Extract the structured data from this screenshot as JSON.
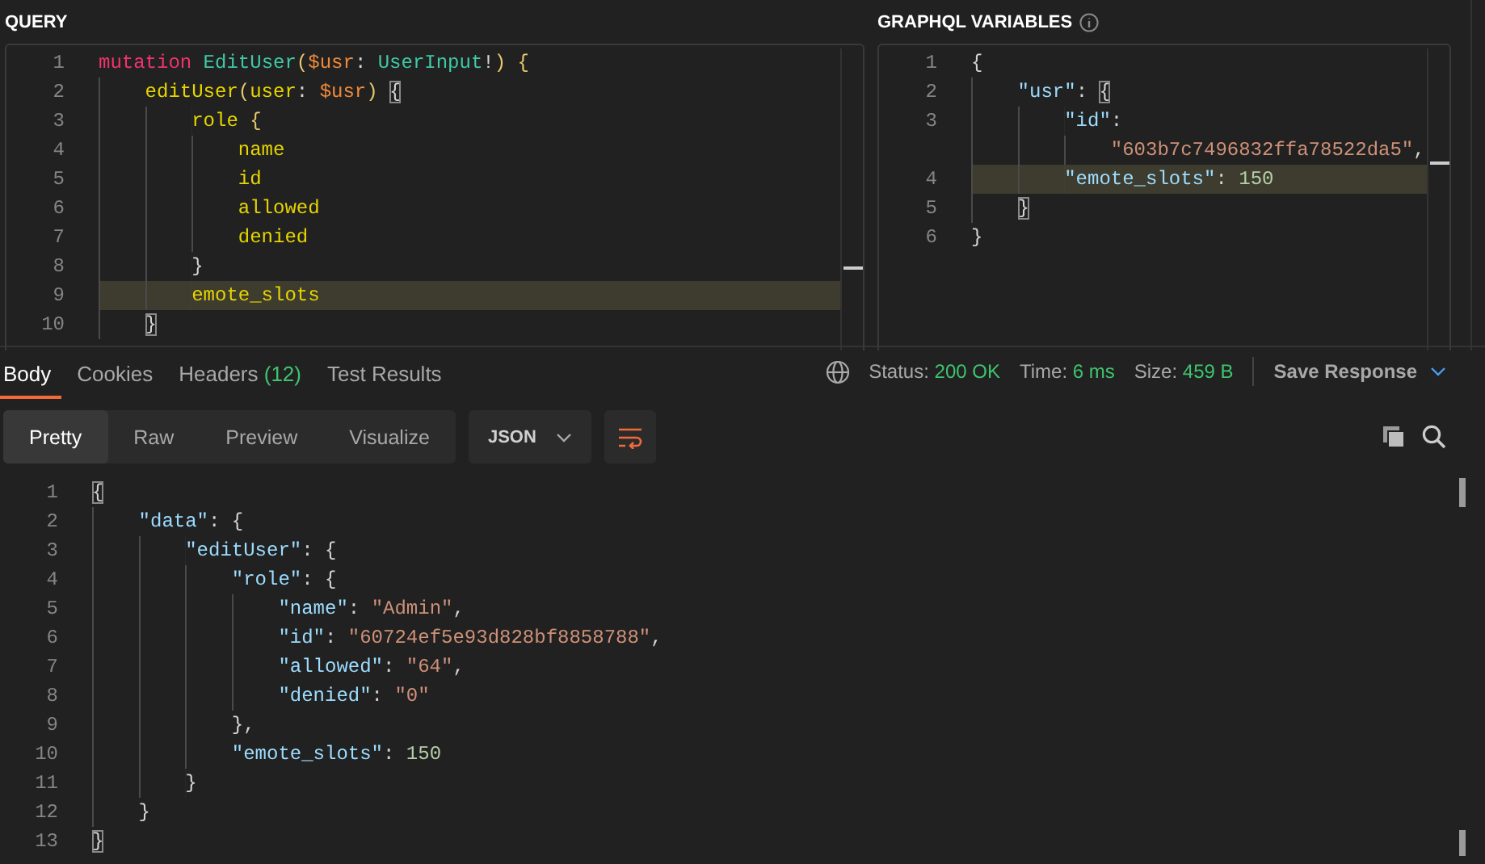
{
  "query": {
    "title": "QUERY",
    "lines": [
      {
        "number": "1",
        "highlighted": false,
        "tokens": [
          {
            "kind": "keyword",
            "text": "mutation"
          },
          {
            "kind": "type",
            "text": " EditUser"
          },
          {
            "kind": "paren",
            "text": "("
          },
          {
            "kind": "variable",
            "text": "$usr"
          },
          {
            "kind": "punct",
            "text": ": "
          },
          {
            "kind": "type",
            "text": "UserInput"
          },
          {
            "kind": "punct",
            "text": "!"
          },
          {
            "kind": "paren",
            "text": ") {"
          }
        ],
        "children": [
          {
            "number": "2",
            "highlighted": false,
            "tokens": [
              {
                "kind": "field",
                "text": "editUser"
              },
              {
                "kind": "paren",
                "text": "("
              },
              {
                "kind": "field",
                "text": "user"
              },
              {
                "kind": "punct",
                "text": ": "
              },
              {
                "kind": "variable",
                "text": "$usr"
              },
              {
                "kind": "paren",
                "text": ") "
              },
              {
                "kind": "match",
                "text": "{"
              }
            ],
            "children": [
              {
                "number": "3",
                "highlighted": false,
                "tokens": [
                  {
                    "kind": "field",
                    "text": "role"
                  },
                  {
                    "kind": "paren",
                    "text": " {"
                  }
                ],
                "children": [
                  {
                    "number": "4",
                    "highlighted": false,
                    "tokens": [
                      {
                        "kind": "field",
                        "text": "name"
                      }
                    ]
                  },
                  {
                    "number": "5",
                    "highlighted": false,
                    "tokens": [
                      {
                        "kind": "field",
                        "text": "id"
                      }
                    ]
                  },
                  {
                    "number": "6",
                    "highlighted": false,
                    "tokens": [
                      {
                        "kind": "field",
                        "text": "allowed"
                      }
                    ]
                  },
                  {
                    "number": "7",
                    "highlighted": false,
                    "tokens": [
                      {
                        "kind": "field",
                        "text": "denied"
                      }
                    ]
                  }
                ]
              },
              {
                "number": "8",
                "highlighted": false,
                "tokens": [
                  {
                    "kind": "punct",
                    "text": "}"
                  }
                ]
              },
              {
                "number": "9",
                "highlighted": true,
                "tokens": [
                  {
                    "kind": "field",
                    "text": "emote_slots"
                  }
                ]
              }
            ]
          },
          {
            "number": "10",
            "highlighted": false,
            "tokens": [
              {
                "kind": "match",
                "text": "}"
              }
            ]
          }
        ]
      }
    ]
  },
  "variables": {
    "title": "GRAPHQL VARIABLES",
    "lines": [
      {
        "number": "1",
        "highlighted": false,
        "tokens": [
          {
            "kind": "punct",
            "text": "{"
          }
        ],
        "children": [
          {
            "number": "2",
            "highlighted": false,
            "tokens": [
              {
                "kind": "key",
                "text": "\"usr\""
              },
              {
                "kind": "punct",
                "text": ": "
              },
              {
                "kind": "match",
                "text": "{"
              }
            ],
            "children": [
              {
                "number": "3",
                "highlighted": false,
                "tokens": [
                  {
                    "kind": "key",
                    "text": "\"id\""
                  },
                  {
                    "kind": "punct",
                    "text": ":"
                  }
                ],
                "children": [
                  {
                    "highlighted": false,
                    "tokens": [
                      {
                        "kind": "string",
                        "text": "\"603b7c7496832ffa78522da5\""
                      },
                      {
                        "kind": "punct",
                        "text": ","
                      }
                    ]
                  }
                ]
              },
              {
                "number": "4",
                "highlighted": true,
                "tokens": [
                  {
                    "kind": "key",
                    "text": "\"emote_slots\""
                  },
                  {
                    "kind": "punct",
                    "text": ": "
                  },
                  {
                    "kind": "number",
                    "text": "150"
                  }
                ]
              }
            ]
          },
          {
            "number": "5",
            "highlighted": false,
            "tokens": [
              {
                "kind": "match",
                "text": "}"
              }
            ]
          }
        ]
      },
      {
        "number": "6",
        "highlighted": false,
        "tokens": [
          {
            "kind": "punct",
            "text": "}"
          }
        ]
      }
    ]
  },
  "response": {
    "tabs": [
      {
        "label": "Body",
        "selected": true
      },
      {
        "label": "Cookies",
        "selected": false
      },
      {
        "label": "Headers",
        "count": "(12)",
        "selected": false
      },
      {
        "label": "Test Results",
        "selected": false
      }
    ],
    "status": [
      {
        "label": "Status:",
        "value": "200 OK"
      },
      {
        "label": "Time:",
        "value": "6 ms"
      },
      {
        "label": "Size:",
        "value": "459 B"
      }
    ],
    "save_button": "Save Response",
    "views": [
      {
        "label": "Pretty",
        "selected": true
      },
      {
        "label": "Raw",
        "selected": false
      },
      {
        "label": "Preview",
        "selected": false
      },
      {
        "label": "Visualize",
        "selected": false
      }
    ],
    "format": "JSON",
    "lines": [
      {
        "number": "1",
        "highlighted": false,
        "tokens": [
          {
            "kind": "match",
            "text": "{"
          }
        ],
        "children": [
          {
            "number": "2",
            "highlighted": false,
            "tokens": [
              {
                "kind": "key",
                "text": "\"data\""
              },
              {
                "kind": "punct",
                "text": ": {"
              }
            ],
            "children": [
              {
                "number": "3",
                "highlighted": false,
                "tokens": [
                  {
                    "kind": "key",
                    "text": "\"editUser\""
                  },
                  {
                    "kind": "punct",
                    "text": ": {"
                  }
                ],
                "children": [
                  {
                    "number": "4",
                    "highlighted": false,
                    "tokens": [
                      {
                        "kind": "key",
                        "text": "\"role\""
                      },
                      {
                        "kind": "punct",
                        "text": ": {"
                      }
                    ],
                    "children": [
                      {
                        "number": "5",
                        "highlighted": false,
                        "tokens": [
                          {
                            "kind": "key",
                            "text": "\"name\""
                          },
                          {
                            "kind": "punct",
                            "text": ": "
                          },
                          {
                            "kind": "string",
                            "text": "\"Admin\""
                          },
                          {
                            "kind": "punct",
                            "text": ","
                          }
                        ]
                      },
                      {
                        "number": "6",
                        "highlighted": false,
                        "tokens": [
                          {
                            "kind": "key",
                            "text": "\"id\""
                          },
                          {
                            "kind": "punct",
                            "text": ": "
                          },
                          {
                            "kind": "string",
                            "text": "\"60724ef5e93d828bf8858788\""
                          },
                          {
                            "kind": "punct",
                            "text": ","
                          }
                        ]
                      },
                      {
                        "number": "7",
                        "highlighted": false,
                        "tokens": [
                          {
                            "kind": "key",
                            "text": "\"allowed\""
                          },
                          {
                            "kind": "punct",
                            "text": ": "
                          },
                          {
                            "kind": "string",
                            "text": "\"64\""
                          },
                          {
                            "kind": "punct",
                            "text": ","
                          }
                        ]
                      },
                      {
                        "number": "8",
                        "highlighted": false,
                        "tokens": [
                          {
                            "kind": "key",
                            "text": "\"denied\""
                          },
                          {
                            "kind": "punct",
                            "text": ": "
                          },
                          {
                            "kind": "string",
                            "text": "\"0\""
                          }
                        ]
                      }
                    ]
                  },
                  {
                    "number": "9",
                    "highlighted": false,
                    "tokens": [
                      {
                        "kind": "punct",
                        "text": "},"
                      }
                    ]
                  },
                  {
                    "number": "10",
                    "highlighted": false,
                    "tokens": [
                      {
                        "kind": "key",
                        "text": "\"emote_slots\""
                      },
                      {
                        "kind": "punct",
                        "text": ": "
                      },
                      {
                        "kind": "number",
                        "text": "150"
                      }
                    ]
                  }
                ]
              },
              {
                "number": "11",
                "highlighted": false,
                "tokens": [
                  {
                    "kind": "punct",
                    "text": "}"
                  }
                ]
              }
            ]
          },
          {
            "number": "12",
            "highlighted": false,
            "tokens": [
              {
                "kind": "punct",
                "text": "}"
              }
            ]
          }
        ]
      },
      {
        "number": "13",
        "highlighted": false,
        "tokens": [
          {
            "kind": "match",
            "text": "}"
          }
        ]
      }
    ]
  }
}
